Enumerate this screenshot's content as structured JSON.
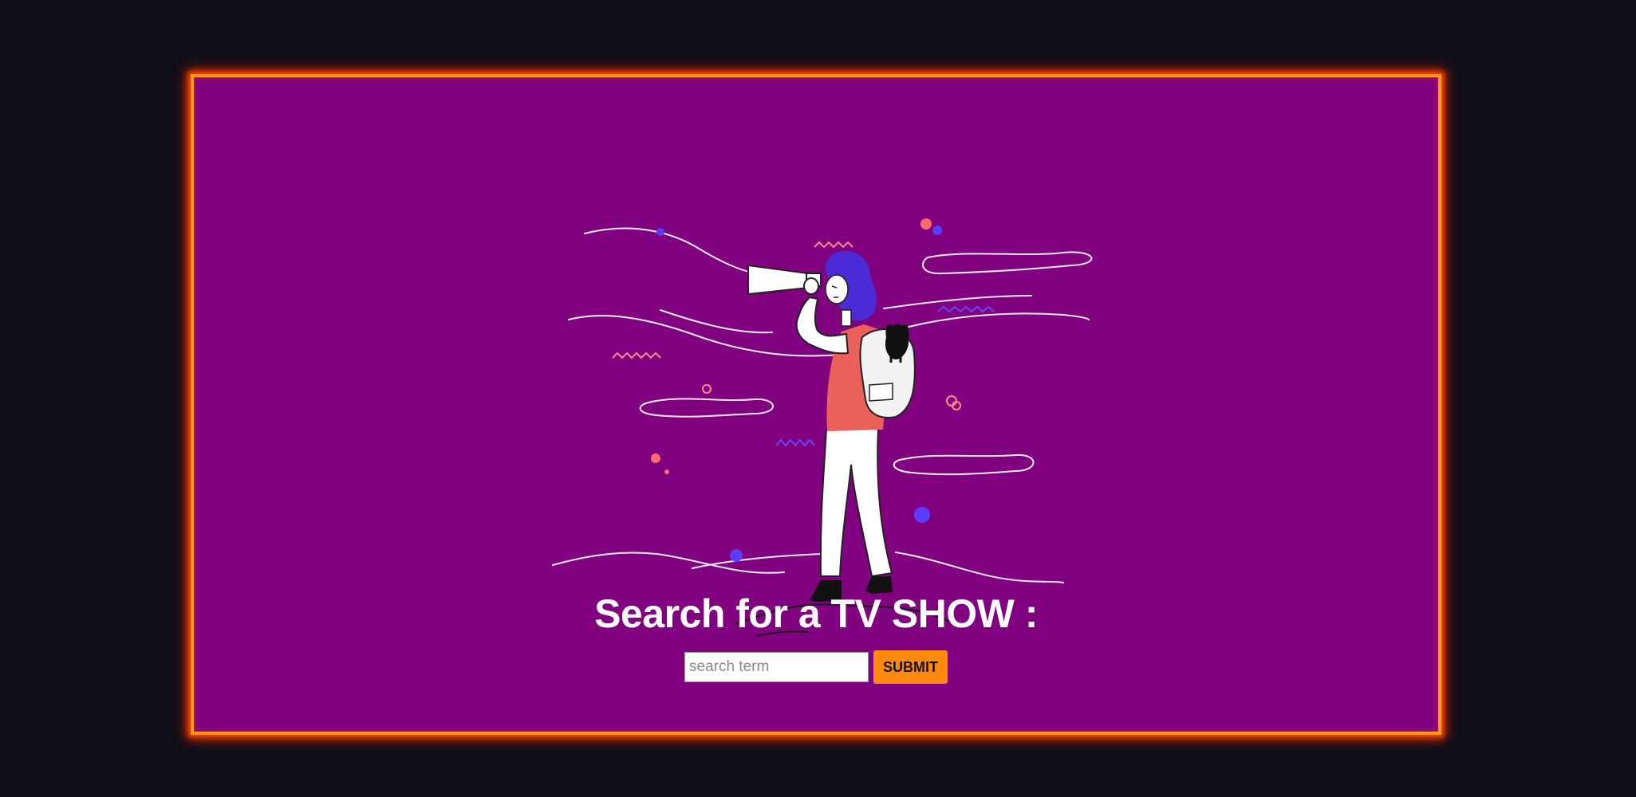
{
  "page": {
    "background_color": "#0f0e17",
    "panel_color": "#800080",
    "glow_color": "#ff4a00"
  },
  "hero": {
    "illustration": "woman-with-telescope-and-cat-backpack",
    "title": "Search for a TV SHOW :"
  },
  "search": {
    "placeholder": "search term",
    "value": "",
    "submit_label": "SUBMIT",
    "submit_color": "#ff8a0d"
  }
}
